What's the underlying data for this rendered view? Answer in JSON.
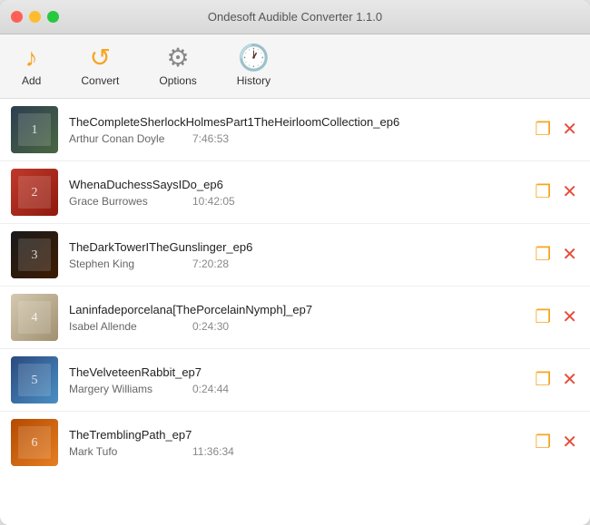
{
  "window": {
    "title": "Ondesoft Audible Converter 1.1.0"
  },
  "toolbar": {
    "add_label": "Add",
    "convert_label": "Convert",
    "options_label": "Options",
    "history_label": "History"
  },
  "books": [
    {
      "id": 1,
      "title": "TheCompleteSherlockHolmesPart1TheHeirloomCollection_ep6",
      "author": "Arthur Conan Doyle",
      "duration": "7:46:53",
      "cover_class": "cover-1"
    },
    {
      "id": 2,
      "title": "WhenaDuchessSaysIDo_ep6",
      "author": "Grace Burrowes",
      "duration": "10:42:05",
      "cover_class": "cover-2"
    },
    {
      "id": 3,
      "title": "TheDarkTowerITheGunslinger_ep6",
      "author": "Stephen King",
      "duration": "7:20:28",
      "cover_class": "cover-3"
    },
    {
      "id": 4,
      "title": "Laninfadeporcelana[ThePorcelainNymph]_ep7",
      "author": "Isabel Allende",
      "duration": "0:24:30",
      "cover_class": "cover-4"
    },
    {
      "id": 5,
      "title": "TheVelveteenRabbit_ep7",
      "author": "Margery Williams",
      "duration": "0:24:44",
      "cover_class": "cover-5"
    },
    {
      "id": 6,
      "title": "TheTremblingPath_ep7",
      "author": "Mark Tufo",
      "duration": "11:36:34",
      "cover_class": "cover-6"
    }
  ]
}
